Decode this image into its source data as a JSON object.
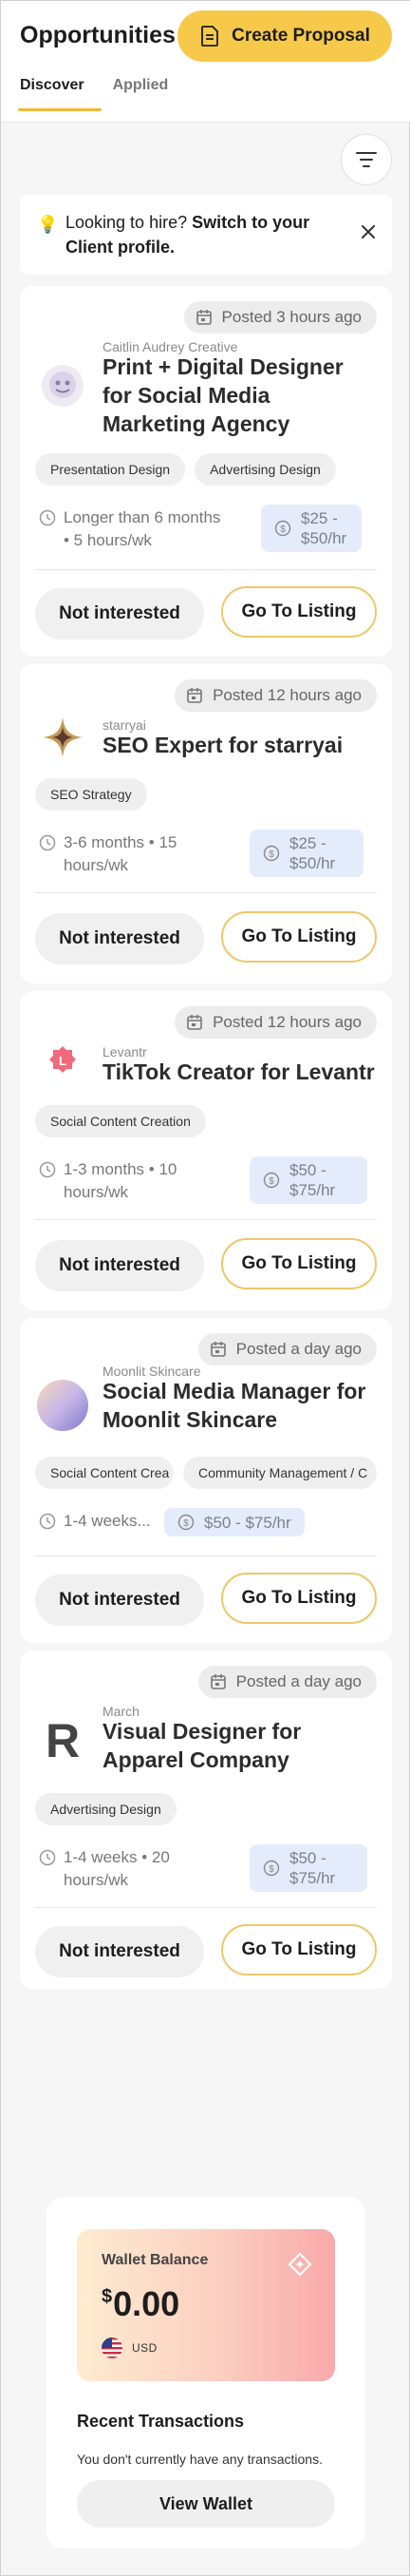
{
  "header": {
    "title": "Opportunities",
    "create_label": "Create Proposal",
    "tabs": [
      {
        "label": "Discover",
        "active": true
      },
      {
        "label": "Applied",
        "active": false
      }
    ]
  },
  "notice": {
    "text_plain": "Looking to hire?",
    "text_bold": "Switch to your Client profile."
  },
  "jobs": [
    {
      "posted": "Posted 3 hours ago",
      "company": "Caitlin Audrey Creative",
      "title": "Print + Digital Designer for Social Media Marketing Agency",
      "tags": [
        "Presentation Design",
        "Advertising Design"
      ],
      "duration": "Longer than 6 months • 5 hours/wk",
      "rate": "$25 - $50/hr",
      "not_interested": "Not interested",
      "go_to_listing": "Go To Listing"
    },
    {
      "posted": "Posted 12 hours ago",
      "company": "starryai",
      "title": "SEO Expert for starryai",
      "tags": [
        "SEO Strategy"
      ],
      "duration": "3-6 months • 15 hours/wk",
      "rate": "$25 - $50/hr",
      "not_interested": "Not interested",
      "go_to_listing": "Go To Listing"
    },
    {
      "posted": "Posted 12 hours ago",
      "company": "Levantr",
      "title": "TikTok Creator for Levantr",
      "tags": [
        "Social Content Creation"
      ],
      "duration": "1-3 months • 10 hours/wk",
      "rate": "$50 - $75/hr",
      "not_interested": "Not interested",
      "go_to_listing": "Go To Listing"
    },
    {
      "posted": "Posted a day ago",
      "company": "Moonlit Skincare",
      "title": "Social Media Manager for Moonlit Skincare",
      "tags": [
        "Social Content Crea",
        "Community Management / C"
      ],
      "duration": "1-4 weeks...",
      "rate": "$50 - $75/hr",
      "not_interested": "Not interested",
      "go_to_listing": "Go To Listing"
    },
    {
      "posted": "Posted a day ago",
      "company": "March",
      "title": "Visual Designer for Apparel Company",
      "tags": [
        "Advertising Design"
      ],
      "duration": "1-4 weeks • 20 hours/wk",
      "rate": "$50 - $75/hr",
      "not_interested": "Not interested",
      "go_to_listing": "Go To Listing"
    }
  ],
  "wallet": {
    "label": "Wallet Balance",
    "currency_symbol": "$",
    "amount": "0.00",
    "currency": "USD",
    "recent_title": "Recent Transactions",
    "empty_text": "You don't currently have any transactions.",
    "view_label": "View Wallet"
  },
  "colors": {
    "accent": "#f6c94a",
    "rate_bg": "#e4ecfb"
  }
}
